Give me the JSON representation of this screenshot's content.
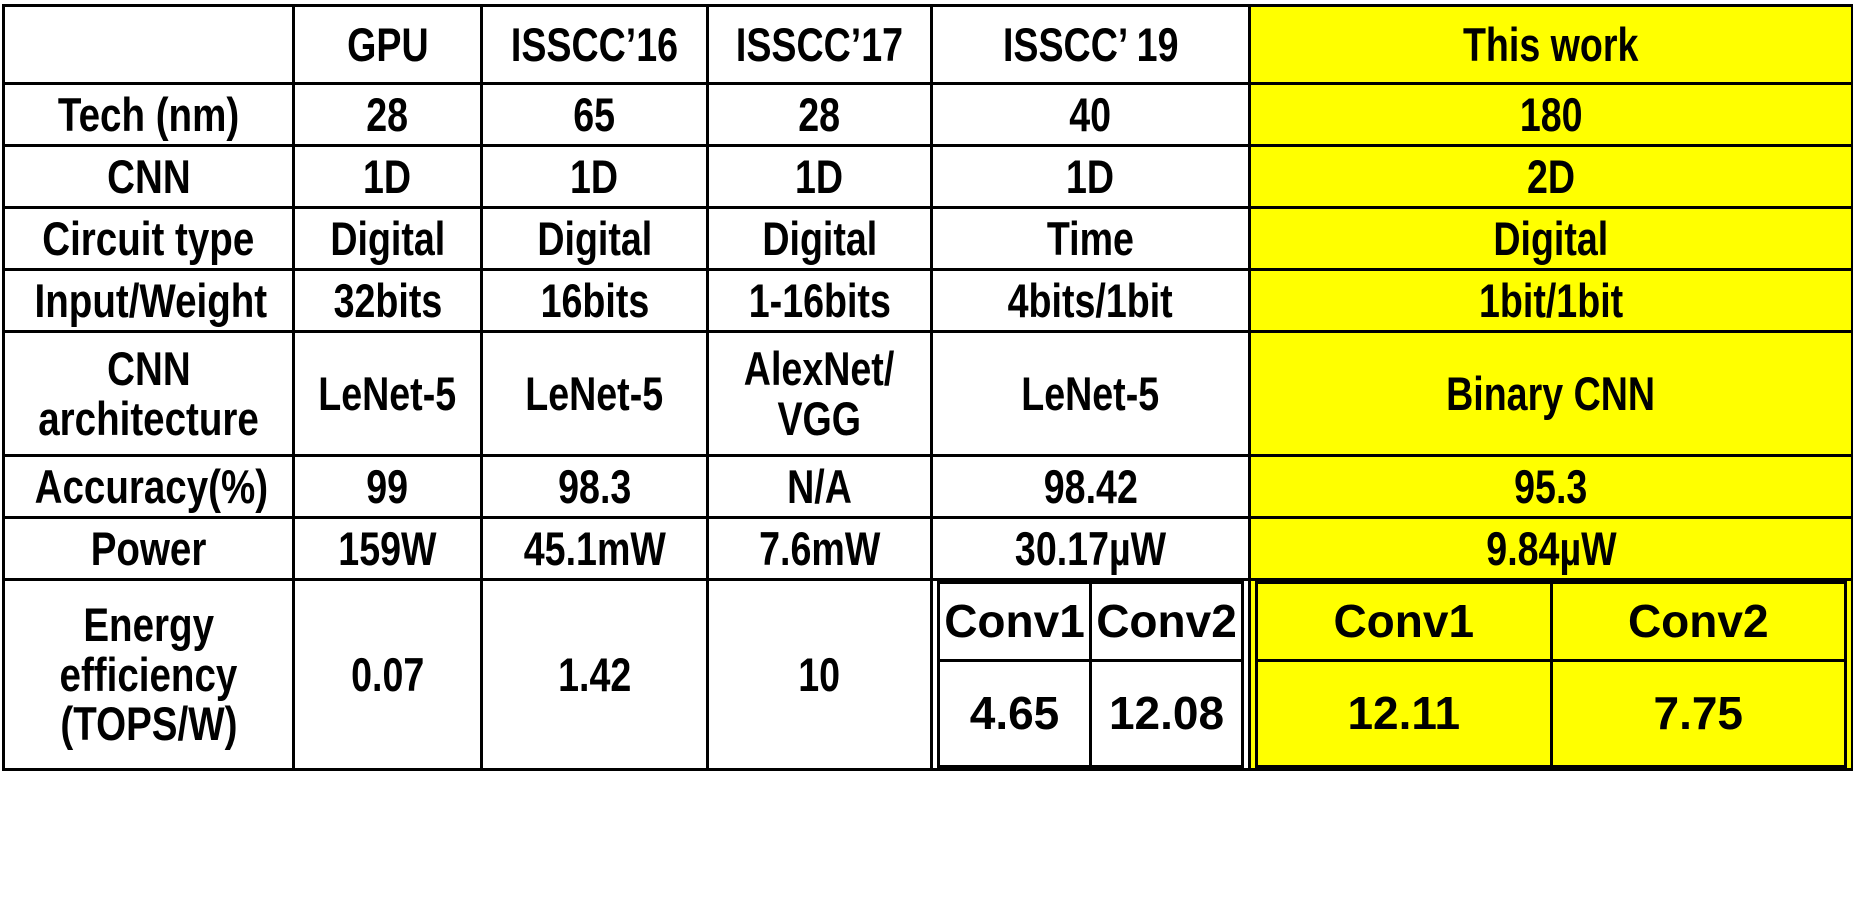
{
  "table": {
    "title": "CNN accelerator comparison table",
    "highlight_color": "#FFFF00",
    "border_color": "#000000",
    "columns": [
      {
        "key": "metric",
        "label": ""
      },
      {
        "key": "gpu",
        "label": "GPU"
      },
      {
        "key": "isscc16",
        "label": "ISSCC’16"
      },
      {
        "key": "isscc17",
        "label": "ISSCC’17"
      },
      {
        "key": "isscc19",
        "label": "ISSCC’ 19"
      },
      {
        "key": "thiswork",
        "label": "This work"
      }
    ],
    "rows": [
      {
        "metric": "Tech (nm)",
        "gpu": "28",
        "isscc16": "65",
        "isscc17": "28",
        "isscc19": "40",
        "thiswork": "180"
      },
      {
        "metric": "CNN",
        "gpu": "1D",
        "isscc16": "1D",
        "isscc17": "1D",
        "isscc19": "1D",
        "thiswork": "2D"
      },
      {
        "metric": "Circuit type",
        "gpu": "Digital",
        "isscc16": "Digital",
        "isscc17": "Digital",
        "isscc19": "Time",
        "thiswork": "Digital"
      },
      {
        "metric": "Input/Weight",
        "gpu": "32bits",
        "isscc16": "16bits",
        "isscc17": "1-16bits",
        "isscc19": "4bits/1bit",
        "thiswork": "1bit/1bit"
      },
      {
        "metric_line1": "CNN",
        "metric_line2": "architecture",
        "gpu": "LeNet-5",
        "isscc16": "LeNet-5",
        "isscc17_line1": "AlexNet/",
        "isscc17_line2": "VGG",
        "isscc19": "LeNet-5",
        "thiswork": "Binary CNN"
      },
      {
        "metric": "Accuracy(%)",
        "gpu": "99",
        "isscc16": "98.3",
        "isscc17": "N/A",
        "isscc19": "98.42",
        "thiswork": "95.3"
      },
      {
        "metric": "Power",
        "gpu": "159W",
        "isscc16": "45.1mW",
        "isscc17": "7.6mW",
        "isscc19": "30.17µW",
        "thiswork": "9.84µW"
      }
    ],
    "energy_row": {
      "metric_line1": "Energy",
      "metric_line2": "efficiency",
      "metric_line3": "(TOPS/W)",
      "gpu": "0.07",
      "isscc16": "1.42",
      "isscc17": "10",
      "isscc19": {
        "conv1_label": "Conv1",
        "conv2_label": "Conv2",
        "conv1_value": "4.65",
        "conv2_value": "12.08"
      },
      "thiswork": {
        "conv1_label": "Conv1",
        "conv2_label": "Conv2",
        "conv1_value": "12.11",
        "conv2_value": "7.75"
      }
    }
  }
}
